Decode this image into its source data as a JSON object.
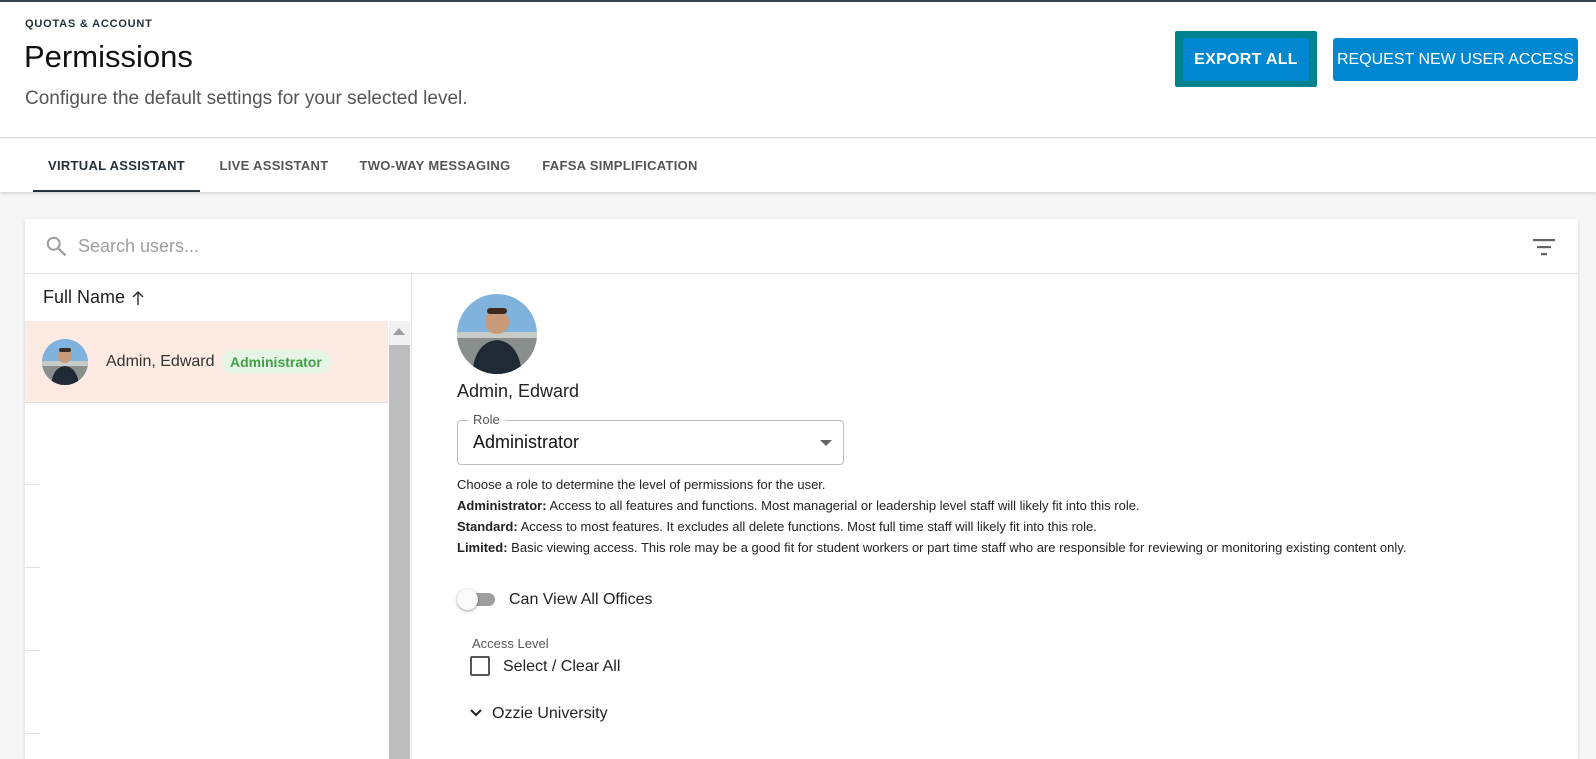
{
  "header": {
    "eyebrow": "QUOTAS & ACCOUNT",
    "title": "Permissions",
    "subtitle": "Configure the default settings for your selected level.",
    "export_label": "EXPORT ALL",
    "request_label": "REQUEST NEW USER ACCESS"
  },
  "tabs": [
    {
      "label": "VIRTUAL ASSISTANT",
      "active": true
    },
    {
      "label": "LIVE ASSISTANT",
      "active": false
    },
    {
      "label": "TWO-WAY MESSAGING",
      "active": false
    },
    {
      "label": "FAFSA SIMPLIFICATION",
      "active": false
    }
  ],
  "search": {
    "placeholder": "Search users...",
    "value": "",
    "icon": "search-icon",
    "filter_icon": "filter-icon"
  },
  "list": {
    "column_header": "Full Name",
    "sort_icon": "arrow-up-icon",
    "users": [
      {
        "name": "Admin, Edward",
        "role": "Administrator",
        "selected": true
      }
    ]
  },
  "detail": {
    "name": "Admin, Edward",
    "role_legend": "Role",
    "role_value": "Administrator",
    "help_intro": "Choose a role to determine the level of permissions for the user.",
    "roles_help": [
      {
        "term": "Administrator:",
        "text": " Access to all features and functions. Most managerial or leadership level staff will likely fit into this role."
      },
      {
        "term": "Standard:",
        "text": " Access to most features. It excludes all delete functions. Most full time staff will likely fit into this role."
      },
      {
        "term": "Limited:",
        "text": " Basic viewing access. This role may be a good fit for student workers or part time staff who are responsible for reviewing or monitoring existing content only."
      }
    ],
    "toggle_label": "Can View All Offices",
    "toggle_on": false,
    "access_level_label": "Access Level",
    "select_all_label": "Select / Clear All",
    "select_all_checked": false,
    "tree": [
      {
        "label": "Ozzie University",
        "expanded": true
      }
    ]
  },
  "colors": {
    "primary": "#0288d1",
    "focus_ring": "#00838f",
    "selected_row": "#fdeae2",
    "badge_text": "#43a047",
    "badge_bg": "#e6f4e6"
  }
}
